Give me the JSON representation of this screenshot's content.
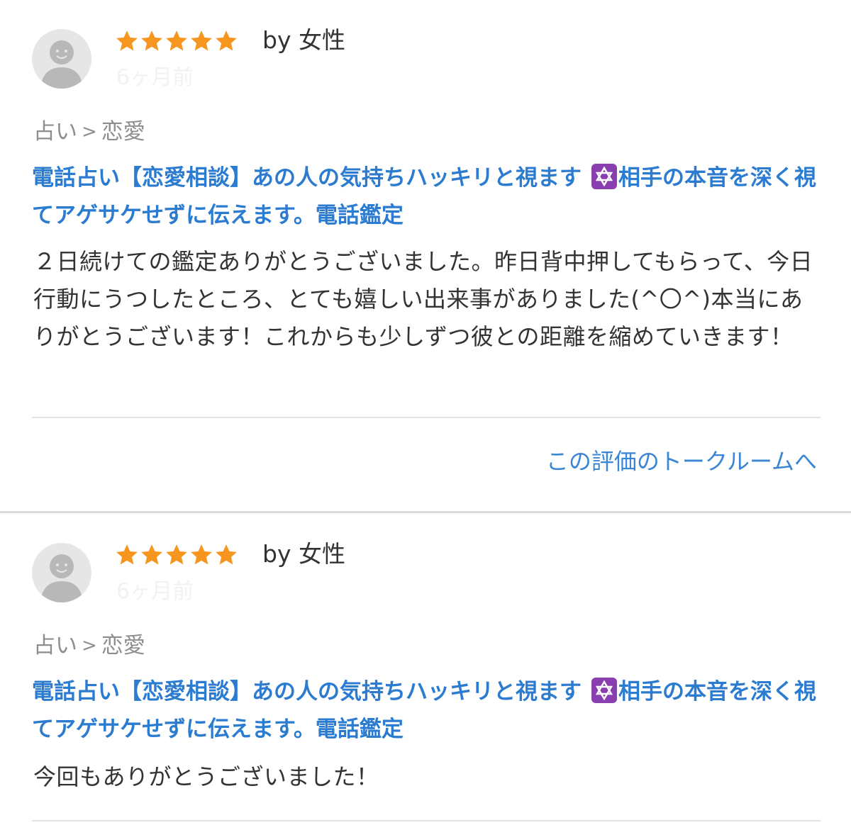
{
  "reviews": [
    {
      "rating": 5,
      "author": "by 女性",
      "time": "6ヶ月前",
      "category": {
        "parent": "占い",
        "separator": ">",
        "child": "恋愛"
      },
      "service_title_part1": "電話占い【恋愛相談】あの人の気持ちハッキリと視ます",
      "service_title_part2": "相手の本音を深く視てアゲサケせずに伝えます。電話鑑定",
      "body": "２日続けての鑑定ありがとうございました。昨日背中押してもらって、今日行動にうつしたところ、とても嬉しい出来事がありました(^〇^)本当にありがとうございます！これからも少しずつ彼との距離を縮めていきます！",
      "link_label": "この評価のトークルームへ"
    },
    {
      "rating": 5,
      "author": "by 女性",
      "time": "6ヶ月前",
      "category": {
        "parent": "占い",
        "separator": ">",
        "child": "恋愛"
      },
      "service_title_part1": "電話占い【恋愛相談】あの人の気持ちハッキリと視ます",
      "service_title_part2": "相手の本音を深く視てアゲサケせずに伝えます。電話鑑定",
      "body": "今回もありがとうございました！"
    }
  ],
  "colors": {
    "star": "#f7961e",
    "link": "#2b7bd0",
    "text": "#333333",
    "muted": "#8e8e8e",
    "divider": "#e3e3e3",
    "emoji_bg": "#8a3fb0"
  },
  "icons": {
    "avatar": "user-avatar-placeholder-icon",
    "star": "star-icon",
    "title_emoji": "six-pointed-star-icon"
  }
}
